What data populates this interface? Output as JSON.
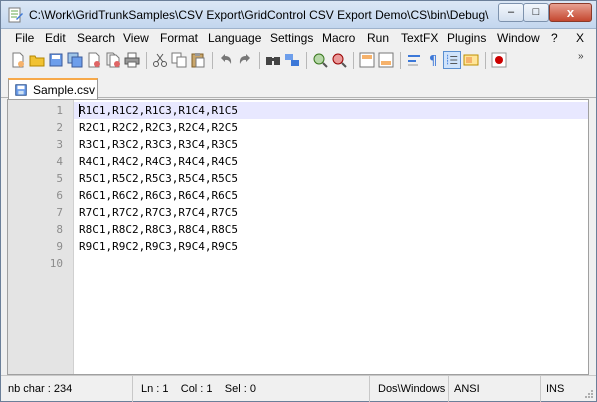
{
  "window": {
    "title": "C:\\Work\\GridTrunkSamples\\CSV Export\\GridControl CSV Export Demo\\CS\\bin\\Debug\\Sam...",
    "close_label": "x",
    "min_label": "–",
    "max_label": "□"
  },
  "menubar": {
    "items": [
      "File",
      "Edit",
      "Search",
      "View",
      "Format",
      "Language",
      "Settings",
      "Macro",
      "Run",
      "TextFX",
      "Plugins",
      "Window",
      "?"
    ],
    "close_doc": "X"
  },
  "toolbar": {
    "buttons": [
      "new-file-icon",
      "open-file-icon",
      "save-icon",
      "save-all-icon",
      "close-icon",
      "close-all-icon",
      "print-icon",
      "cut-icon",
      "copy-icon",
      "paste-icon",
      "undo-icon",
      "redo-icon",
      "find-icon",
      "replace-icon",
      "zoom-in-icon",
      "zoom-out-icon",
      "sync-vertical-icon",
      "sync-horizontal-icon",
      "word-wrap-icon",
      "show-all-chars-icon",
      "indent-guide-icon",
      "user-lang-icon",
      "record-macro-icon"
    ],
    "more_label": "»"
  },
  "tabs": [
    {
      "label": "Sample.csv",
      "active": true
    }
  ],
  "editor": {
    "line_numbers": [
      "1",
      "2",
      "3",
      "4",
      "5",
      "6",
      "7",
      "8",
      "9",
      "10"
    ],
    "lines": [
      "R1C1,R1C2,R1C3,R1C4,R1C5",
      "R2C1,R2C2,R2C3,R2C4,R2C5",
      "R3C1,R3C2,R3C3,R3C4,R3C5",
      "R4C1,R4C2,R4C3,R4C4,R4C5",
      "R5C1,R5C2,R5C3,R5C4,R5C5",
      "R6C1,R6C2,R6C3,R6C4,R6C5",
      "R7C1,R7C2,R7C3,R7C4,R7C5",
      "R8C1,R8C2,R8C3,R8C4,R8C5",
      "R9C1,R9C2,R9C3,R9C4,R9C5",
      ""
    ],
    "current_line": 1
  },
  "statusbar": {
    "nb_char": "nb char : 234",
    "position": "Ln : 1    Col : 1    Sel : 0",
    "eol": "Dos\\Windows",
    "encoding": "ANSI",
    "mode": "INS"
  },
  "colors": {
    "tab_accent": "#f7a94a",
    "current_line_bg": "#e8e8ff",
    "gutter_bg": "#e4e4e4"
  }
}
